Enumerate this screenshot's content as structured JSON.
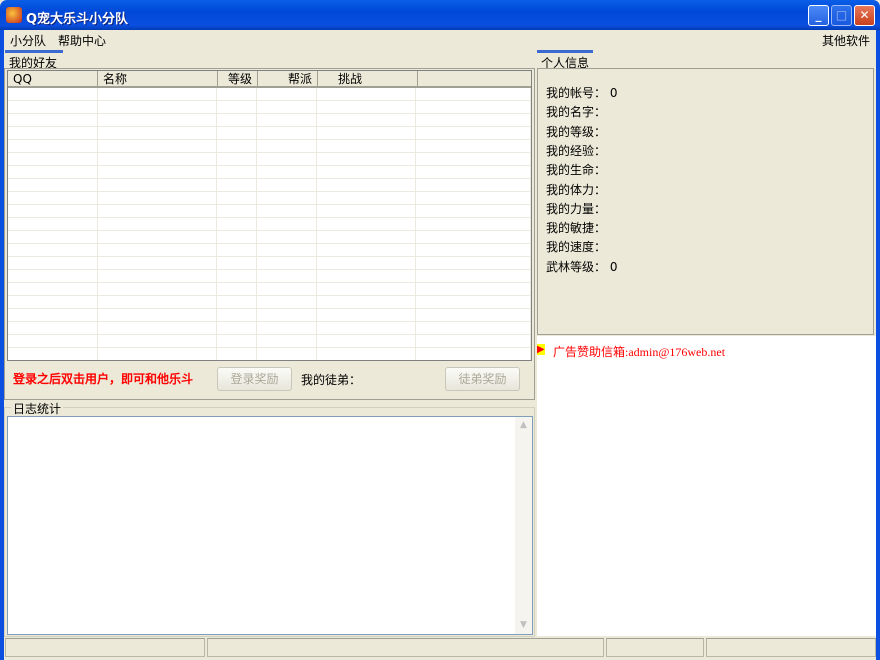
{
  "window": {
    "title": "Q宠大乐斗小分队"
  },
  "menu": {
    "items": [
      "小分队",
      "帮助中心"
    ],
    "right": "其他软件"
  },
  "friends": {
    "tab": "我的好友",
    "columns": [
      "QQ",
      "名称",
      "等级",
      "帮派",
      "挑战"
    ],
    "row_count": 21,
    "hint": "登录之后双击用户，即可和他乐斗",
    "login_reward": "登录奖励",
    "apprentice_label": "我的徒弟：",
    "apprentice_reward": "徒弟奖励"
  },
  "log": {
    "title": "日志统计"
  },
  "profile": {
    "tab": "个人信息",
    "fields": [
      {
        "label": "我的帐号：",
        "value": "0"
      },
      {
        "label": "我的名字：",
        "value": ""
      },
      {
        "label": "我的等级：",
        "value": ""
      },
      {
        "label": "我的经验：",
        "value": ""
      },
      {
        "label": "我的生命：",
        "value": ""
      },
      {
        "label": "我的体力：",
        "value": ""
      },
      {
        "label": "我的力量：",
        "value": ""
      },
      {
        "label": "我的敏捷：",
        "value": ""
      },
      {
        "label": "我的速度：",
        "value": ""
      },
      {
        "label": "武林等级：",
        "value": "0"
      }
    ]
  },
  "ad": {
    "text": "广告赞助信箱:admin@176web.net",
    "color": "#ff0000"
  }
}
